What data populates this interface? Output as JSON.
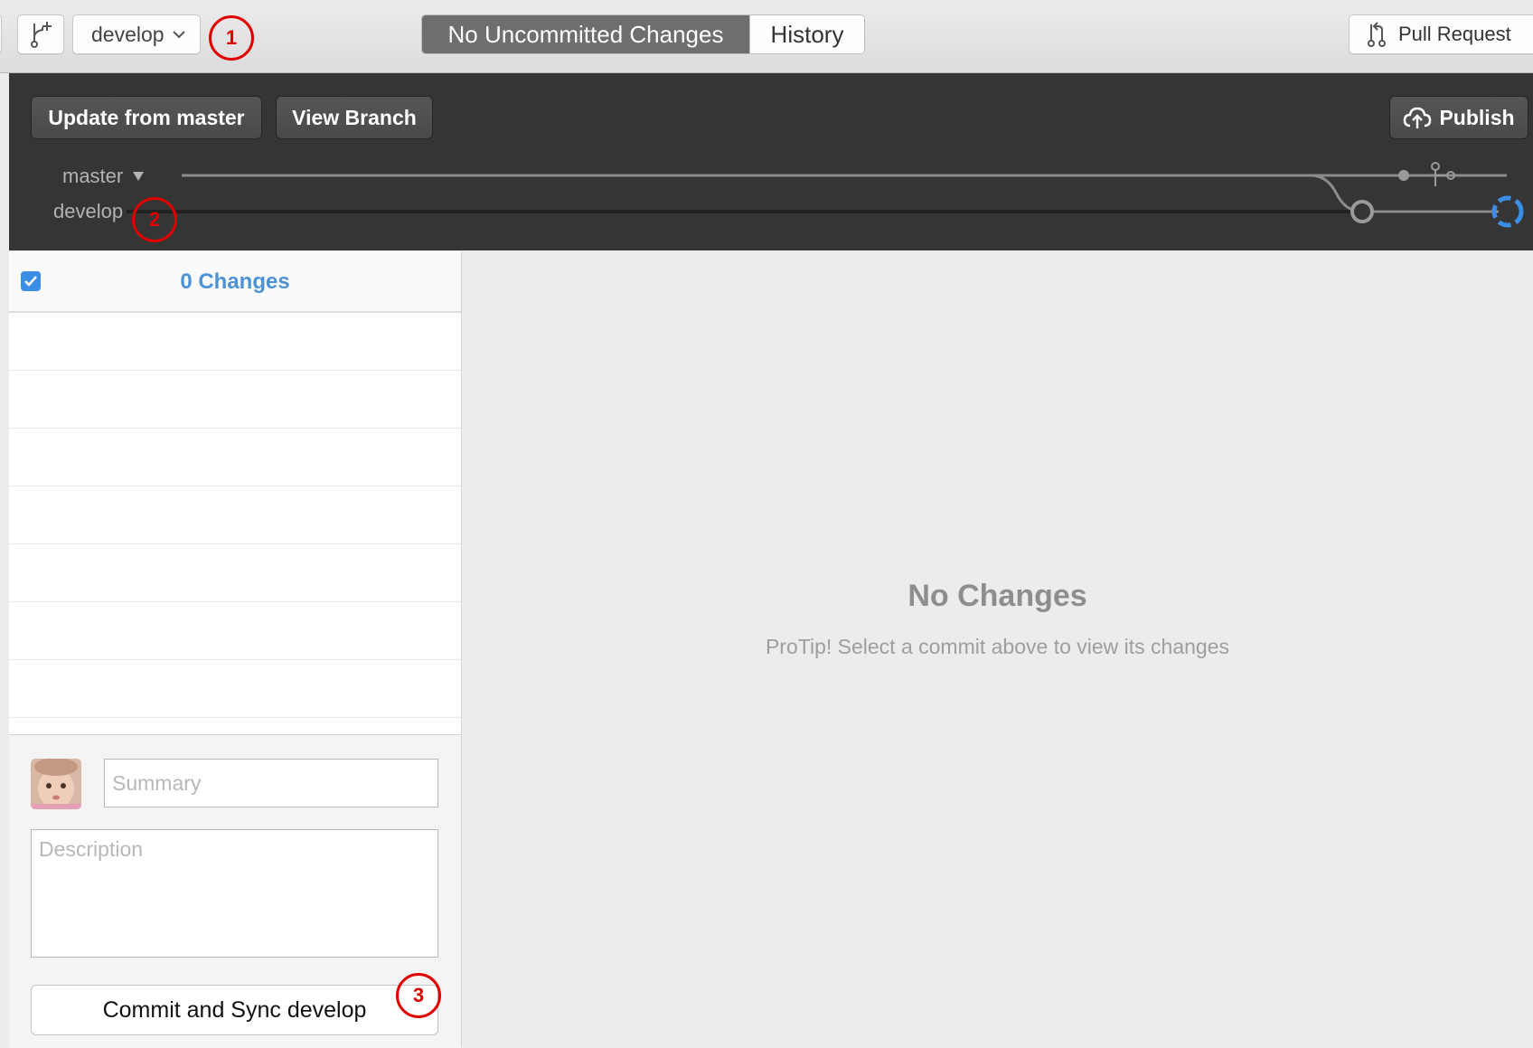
{
  "toolbar": {
    "current_branch": "develop",
    "tabs": [
      {
        "label": "No Uncommitted Changes",
        "active": true
      },
      {
        "label": "History",
        "active": false
      }
    ],
    "pull_request_label": "Pull Request"
  },
  "branch_panel": {
    "update_label": "Update from master",
    "view_branch_label": "View Branch",
    "publish_label": "Publish",
    "branches": [
      {
        "name": "master",
        "has_menu": true
      },
      {
        "name": "develop",
        "has_menu": false
      }
    ]
  },
  "changes": {
    "title": "0 Changes",
    "select_all_checked": true
  },
  "commit": {
    "summary_placeholder": "Summary",
    "description_placeholder": "Description",
    "button_label": "Commit and Sync develop"
  },
  "empty_state": {
    "title": "No Changes",
    "subtitle": "ProTip! Select a commit above to view its changes"
  },
  "annotations": [
    "1",
    "2",
    "3"
  ],
  "colors": {
    "accent": "#4c93d6",
    "dark_panel": "#353535",
    "annotation": "#e00000",
    "sync_indicator": "#3a8ee6"
  }
}
